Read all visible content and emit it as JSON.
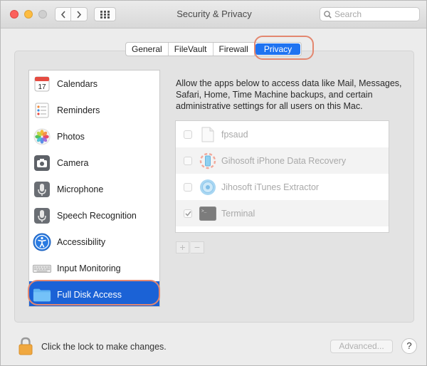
{
  "window": {
    "title": "Security & Privacy"
  },
  "search": {
    "placeholder": "Search"
  },
  "tabs": [
    {
      "label": "General"
    },
    {
      "label": "FileVault"
    },
    {
      "label": "Firewall"
    },
    {
      "label": "Privacy",
      "active": true
    }
  ],
  "sidebar": {
    "items": [
      {
        "label": "Calendars",
        "icon": "calendar-icon",
        "icon_text": "17"
      },
      {
        "label": "Reminders",
        "icon": "reminders-icon"
      },
      {
        "label": "Photos",
        "icon": "photos-icon"
      },
      {
        "label": "Camera",
        "icon": "camera-icon"
      },
      {
        "label": "Microphone",
        "icon": "microphone-icon"
      },
      {
        "label": "Speech Recognition",
        "icon": "speech-recognition-icon"
      },
      {
        "label": "Accessibility",
        "icon": "accessibility-icon"
      },
      {
        "label": "Input Monitoring",
        "icon": "keyboard-icon"
      },
      {
        "label": "Full Disk Access",
        "icon": "folder-icon",
        "selected": true
      }
    ]
  },
  "main": {
    "description": "Allow the apps below to access data like Mail, Messages, Safari, Home, Time Machine backups, and certain administrative settings for all users on this Mac.",
    "apps": [
      {
        "name": "fpsaud",
        "checked": false,
        "icon": "generic-file-icon"
      },
      {
        "name": "Gihosoft iPhone Data Recovery",
        "checked": false,
        "icon": "gihosoft-recovery-icon"
      },
      {
        "name": "Jihosoft iTunes Extractor",
        "checked": false,
        "icon": "itunes-extractor-icon"
      },
      {
        "name": "Terminal",
        "checked": true,
        "icon": "terminal-icon",
        "icon_text": ">_"
      }
    ],
    "add_label": "+",
    "remove_label": "−"
  },
  "footer": {
    "lock_text": "Click the lock to make changes.",
    "advanced_label": "Advanced...",
    "help_label": "?"
  },
  "colors": {
    "accent": "#1f73f1",
    "selection": "#1b62d6",
    "annotation": "#e3876f"
  }
}
